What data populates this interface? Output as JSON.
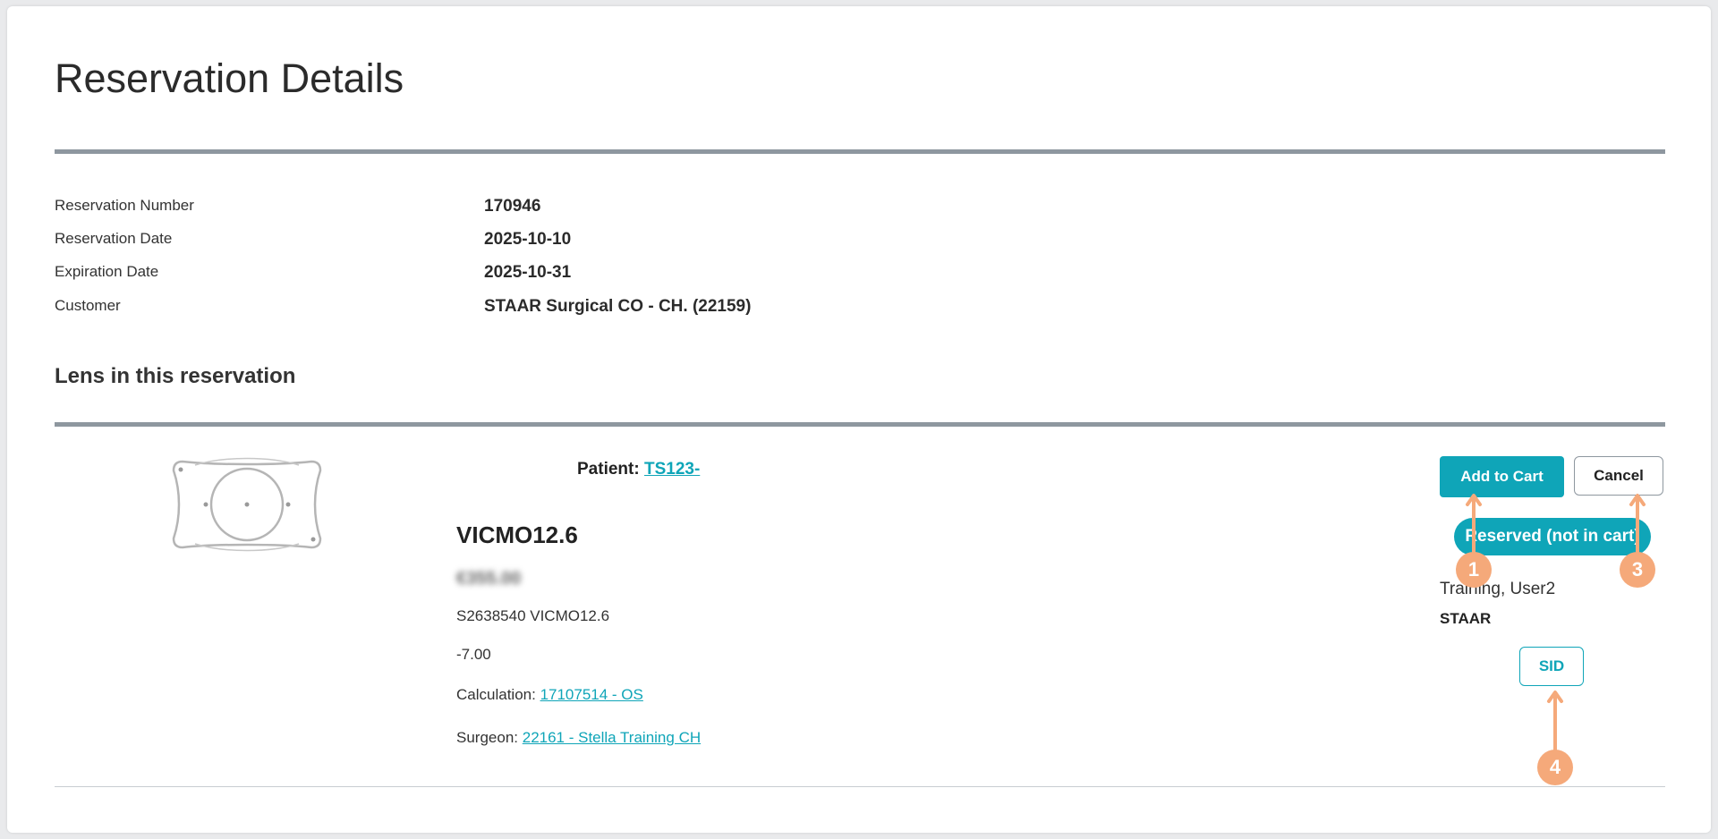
{
  "page": {
    "title": "Reservation Details"
  },
  "reservation": {
    "rows": [
      {
        "label": "Reservation Number",
        "value": "170946"
      },
      {
        "label": "Reservation Date",
        "value": "2025-10-10"
      },
      {
        "label": "Expiration Date",
        "value": "2025-10-31"
      },
      {
        "label": "Customer",
        "value": "STAAR Surgical CO - CH. (22159)"
      }
    ]
  },
  "lens_section": {
    "title": "Lens in this reservation"
  },
  "lens": {
    "patient_label": "Patient:",
    "patient_id": "TS123-",
    "product_name": "VICMO12.6",
    "price": "€355.00",
    "serial": "S2638540 VICMO12.6",
    "power": "-7.00",
    "calculation_label": "Calculation:",
    "calculation_link": "17107514 - OS",
    "surgeon_label": "Surgeon:",
    "surgeon_link": "22161 - Stella Training CH"
  },
  "actions": {
    "add_to_cart": "Add to Cart",
    "cancel": "Cancel",
    "status": "Reserved (not in cart)",
    "user": "Training, User2",
    "company": "STAAR",
    "sid": "SID"
  },
  "annotations": {
    "markers": [
      "1",
      "3",
      "4"
    ]
  },
  "colors": {
    "accent": "#0fa5b8",
    "rule": "#8e979f",
    "annotation": "#f5a97a"
  }
}
